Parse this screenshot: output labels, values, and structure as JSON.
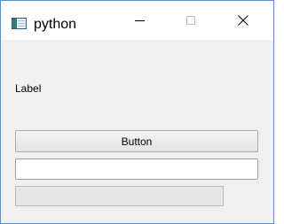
{
  "window": {
    "title": "python",
    "icon": "qt-window-icon",
    "controls": {
      "minimize_icon": "minimize-icon",
      "maximize_icon": "maximize-icon",
      "close_icon": "close-icon"
    }
  },
  "content": {
    "label_text": "Label",
    "button_label": "Button",
    "line_edit_value": "",
    "progress_fraction": 0
  },
  "colors": {
    "window_border": "#5a8fc9",
    "client_background": "#f0f0f0",
    "titlebar_background": "#ffffff"
  }
}
